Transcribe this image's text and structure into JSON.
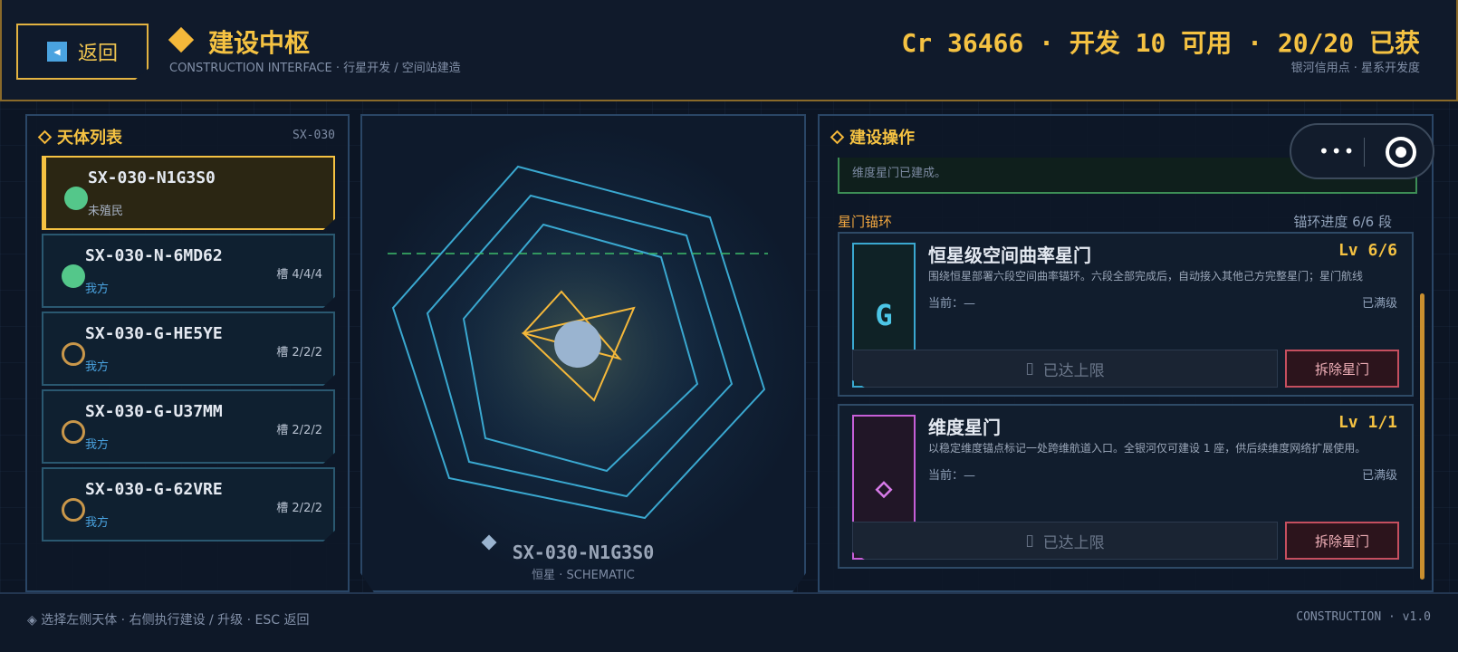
{
  "header": {
    "back_label": "返回",
    "title": "建设中枢",
    "subtitle": "CONSTRUCTION INTERFACE  ·  行星开发 / 空间站建造",
    "resources": "Cr 36466  ·  开发 10 可用  · 20/20 已获",
    "resources_sub": "银河信用点 · 星系开发度"
  },
  "left": {
    "title": "天体列表",
    "code": "SX-030",
    "items": [
      {
        "name": "SX-030-N1G3S0",
        "status": "未殖民",
        "slots": ""
      },
      {
        "name": "SX-030-N-6MD62",
        "status": "我方",
        "slots": "槽 4/4/4"
      },
      {
        "name": "SX-030-G-HE5YE",
        "status": "我方",
        "slots": "槽 2/2/2"
      },
      {
        "name": "SX-030-G-U37MM",
        "status": "我方",
        "slots": "槽 2/2/2"
      },
      {
        "name": "SX-030-G-62VRE",
        "status": "我方",
        "slots": "槽 2/2/2"
      }
    ]
  },
  "center": {
    "name": "SX-030-N1G3S0",
    "sub": "恒星 · SCHEMATIC",
    "colors": {
      "hex": "#3aa8d0",
      "star": "#f5b83a",
      "core": "#9ab4d0",
      "dash": "#3dbb6a"
    }
  },
  "right": {
    "title": "建设操作",
    "message": "维度星门已建成。",
    "section_label": "星门锚环",
    "section_progress": "锚环进度 6/6 段",
    "gates": [
      {
        "icon": "G",
        "name": "恒星级空间曲率星门",
        "level": "Lv 6/6",
        "desc": "围绕恒星部署六段空间曲率锚环。六段全部完成后，自动接入其他己方完整星门；星门航线",
        "current": "当前：—",
        "state": "已满级",
        "max_label": "已达上限",
        "remove_label": "拆除星门",
        "color": "#3aa8d0"
      },
      {
        "icon": "◇",
        "name": "维度星门",
        "level": "Lv 1/1",
        "desc": "以稳定维度锚点标记一处跨维航道入口。全银河仅可建设 1 座，供后续维度网络扩展使用。",
        "current": "当前：—",
        "state": "已满级",
        "max_label": "已达上限",
        "remove_label": "拆除星门",
        "color": "#c65fd8"
      }
    ]
  },
  "footer": {
    "left": "◈ 选择左侧天体  ·  右侧执行建设 / 升级  ·  ESC 返回",
    "right": "CONSTRUCTION · v1.0"
  },
  "controls": {
    "more": "•••"
  }
}
